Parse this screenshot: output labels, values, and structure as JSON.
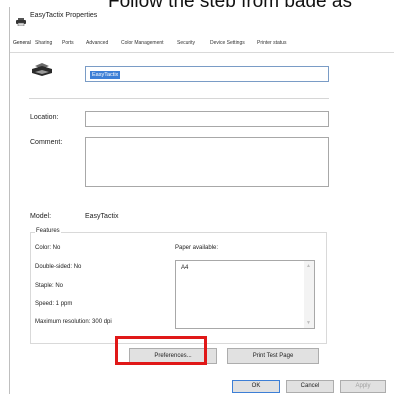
{
  "caption": {
    "text": "Follow the step from page as"
  },
  "window": {
    "title": "EasyTactix Properties",
    "icons": {
      "title": "printer-icon",
      "main": "printer-icon"
    }
  },
  "tabs": [
    {
      "label": "General",
      "active": true
    },
    {
      "label": "Sharing"
    },
    {
      "label": "Ports"
    },
    {
      "label": "Advanced"
    },
    {
      "label": "Color Management"
    },
    {
      "label": "Security"
    },
    {
      "label": "Device Settings"
    },
    {
      "label": "Printer status"
    }
  ],
  "general": {
    "printer_name": "EasyTactix",
    "location_label": "Location:",
    "location_value": "",
    "comment_label": "Comment:",
    "comment_value": "",
    "model_label": "Model:",
    "model_value": "EasyTactix"
  },
  "features": {
    "title": "Features",
    "color": "Color: No",
    "double_sided": "Double-sided: No",
    "staple": "Staple: No",
    "speed": "Speed: 1 ppm",
    "max_resolution": "Maximum resolution: 300 dpi",
    "paper_label": "Paper available:",
    "paper_items": [
      "A4"
    ]
  },
  "buttons": {
    "preferences": "Preferences...",
    "print_test_page": "Print Test Page",
    "ok": "OK",
    "cancel": "Cancel",
    "apply": "Apply"
  },
  "colors": {
    "highlight": "#e01818",
    "selection": "#3d7fd6",
    "field_border_focus": "#7a9cc6"
  }
}
